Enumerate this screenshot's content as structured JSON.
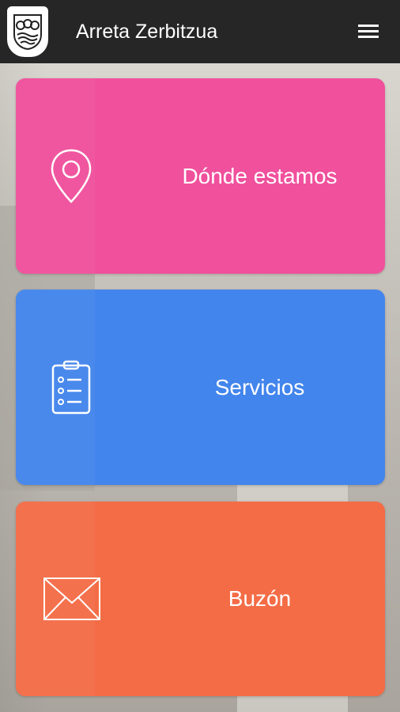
{
  "app": {
    "title": "Arreta Zerbitzua"
  },
  "header": {
    "logo_icon": "basque-shield-icon",
    "menu_icon": "hamburger-menu-icon"
  },
  "cards": [
    {
      "label": "Dónde estamos",
      "icon": "location-pin-icon",
      "color": "#f0509c"
    },
    {
      "label": "Servicios",
      "icon": "clipboard-list-icon",
      "color": "#4285ec"
    },
    {
      "label": "Buzón",
      "icon": "envelope-icon",
      "color": "#f46c46"
    }
  ],
  "colors": {
    "topbar": "#262626"
  }
}
